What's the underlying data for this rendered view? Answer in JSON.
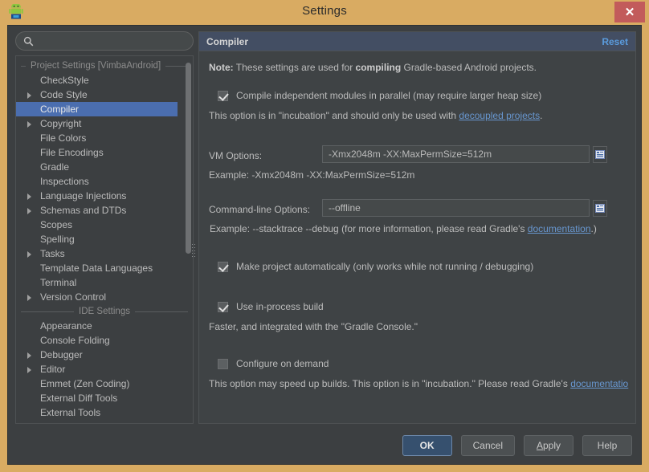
{
  "window": {
    "title": "Settings",
    "app_icon": "android-robot-icon",
    "close_label": "✕"
  },
  "sidebar": {
    "search": {
      "value": "",
      "placeholder": ""
    },
    "groups": [
      {
        "label": "Project Settings [VimbaAndroid]",
        "items": [
          {
            "label": "CheckStyle",
            "arrow": false,
            "selected": false
          },
          {
            "label": "Code Style",
            "arrow": true,
            "selected": false
          },
          {
            "label": "Compiler",
            "arrow": false,
            "selected": true
          },
          {
            "label": "Copyright",
            "arrow": true,
            "selected": false
          },
          {
            "label": "File Colors",
            "arrow": false,
            "selected": false
          },
          {
            "label": "File Encodings",
            "arrow": false,
            "selected": false
          },
          {
            "label": "Gradle",
            "arrow": false,
            "selected": false
          },
          {
            "label": "Inspections",
            "arrow": false,
            "selected": false
          },
          {
            "label": "Language Injections",
            "arrow": true,
            "selected": false
          },
          {
            "label": "Schemas and DTDs",
            "arrow": true,
            "selected": false
          },
          {
            "label": "Scopes",
            "arrow": false,
            "selected": false
          },
          {
            "label": "Spelling",
            "arrow": false,
            "selected": false
          },
          {
            "label": "Tasks",
            "arrow": true,
            "selected": false
          },
          {
            "label": "Template Data Languages",
            "arrow": false,
            "selected": false
          },
          {
            "label": "Terminal",
            "arrow": false,
            "selected": false
          },
          {
            "label": "Version Control",
            "arrow": true,
            "selected": false
          }
        ]
      },
      {
        "label": "IDE Settings",
        "items": [
          {
            "label": "Appearance",
            "arrow": false,
            "selected": false
          },
          {
            "label": "Console Folding",
            "arrow": false,
            "selected": false
          },
          {
            "label": "Debugger",
            "arrow": true,
            "selected": false
          },
          {
            "label": "Editor",
            "arrow": true,
            "selected": false
          },
          {
            "label": "Emmet (Zen Coding)",
            "arrow": false,
            "selected": false
          },
          {
            "label": "External Diff Tools",
            "arrow": false,
            "selected": false
          },
          {
            "label": "External Tools",
            "arrow": false,
            "selected": false
          }
        ]
      }
    ]
  },
  "panel": {
    "title": "Compiler",
    "reset_label": "Reset",
    "note_prefix": "Note:",
    "note_mid_a": " These settings are used for ",
    "note_bold_b": "compiling",
    "note_tail": " Gradle-based Android projects.",
    "parallel": {
      "checked": true,
      "label": "Compile independent modules in parallel (may require larger heap size)",
      "desc_a": "This option is in \"incubation\" and should only be used with ",
      "desc_link": "decoupled projects",
      "desc_b": "."
    },
    "vm_options": {
      "label": "VM Options:",
      "value": "-Xmx2048m -XX:MaxPermSize=512m",
      "example": "Example: -Xmx2048m -XX:MaxPermSize=512m",
      "expand_icon": "expand-editor-icon"
    },
    "cmdline_options": {
      "label": "Command-line Options:",
      "value": "--offline",
      "example_a": "Example: --stacktrace --debug (for more information, please read Gradle's ",
      "example_link": "documentation",
      "example_b": ".)",
      "expand_icon": "expand-editor-icon"
    },
    "make_auto": {
      "checked": true,
      "label": "Make project automatically (only works while not running / debugging)"
    },
    "in_process": {
      "checked": true,
      "label": "Use in-process build",
      "desc": "Faster, and integrated with the \"Gradle Console.\""
    },
    "configure_on_demand": {
      "checked": false,
      "label": "Configure on demand",
      "desc_a": "This option may speed up builds. This option is in \"incubation.\" Please read Gradle's ",
      "desc_link": "documentatio"
    }
  },
  "footer": {
    "ok": "OK",
    "cancel": "Cancel",
    "apply_a": "A",
    "apply_b": "pply",
    "help": "Help"
  },
  "colors": {
    "titlebar": "#d9ab62",
    "close": "#c25b5b",
    "dialog_bg": "#3c3f41",
    "panel_bg": "#3f4345",
    "panel_header": "#434e63",
    "selection": "#4b6eaf",
    "link": "#6897d0",
    "reset_link": "#5a9bdd",
    "primary_button": "#36506e",
    "text": "#bbbbbb"
  }
}
